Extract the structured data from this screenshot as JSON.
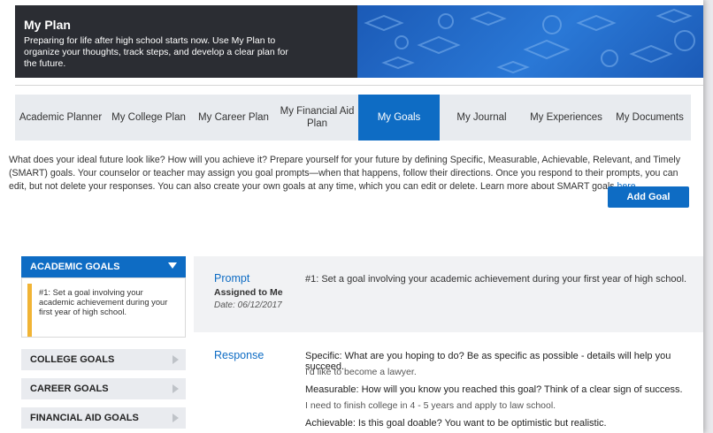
{
  "header": {
    "title": "My Plan",
    "description": "Preparing for life after high school starts now. Use My Plan to organize your thoughts, track steps, and develop a clear plan for the future."
  },
  "tabs": [
    {
      "label": "Academic Planner"
    },
    {
      "label": "My College Plan"
    },
    {
      "label": "My Career Plan"
    },
    {
      "label": "My Financial Aid Plan"
    },
    {
      "label": "My Goals"
    },
    {
      "label": "My Journal"
    },
    {
      "label": "My Experiences"
    },
    {
      "label": "My Documents"
    }
  ],
  "active_tab": "My Goals",
  "intro": {
    "text": "What does your ideal future look like? How will you achieve it? Prepare yourself for your future by defining Specific, Measurable, Achievable, Relevant, and Timely (SMART) goals. Your counselor or teacher may assign you goal prompts—when that happens, follow their directions. Once you respond to their prompts, you can edit, but not delete your responses. You can also create your own goals at any time, which you can edit or delete. Learn more about SMART goals ",
    "link": "here"
  },
  "add_goal_label": "Add Goal",
  "sidebar": {
    "active_category": "ACADEMIC GOALS",
    "active_item": "#1: Set a goal involving your academic achievement during your first year of high school.",
    "categories": [
      {
        "label": "COLLEGE GOALS"
      },
      {
        "label": "CAREER GOALS"
      },
      {
        "label": "FINANCIAL AID GOALS"
      }
    ]
  },
  "detail": {
    "prompt_label": "Prompt",
    "assigned": "Assigned to Me",
    "date": "Date: 06/12/2017",
    "prompt_text": "#1: Set a goal involving your academic achievement during your first year of high school.",
    "response_label": "Response",
    "response": [
      {
        "q": "Specific: What are you hoping to do? Be as specific as possible - details will help you succeed.",
        "a": "I'd like to become a lawyer."
      },
      {
        "q": "Measurable: How will you know you reached this goal? Think of a clear sign of success.",
        "a": "I need to finish college in 4 - 5 years and apply to law school."
      },
      {
        "q": "Achievable: Is this goal doable? You want to be optimistic but realistic.",
        "a": ""
      }
    ]
  },
  "colors": {
    "accent": "#0e6cc4",
    "header_dark": "#2b2d33",
    "highlight": "#f1b435"
  }
}
